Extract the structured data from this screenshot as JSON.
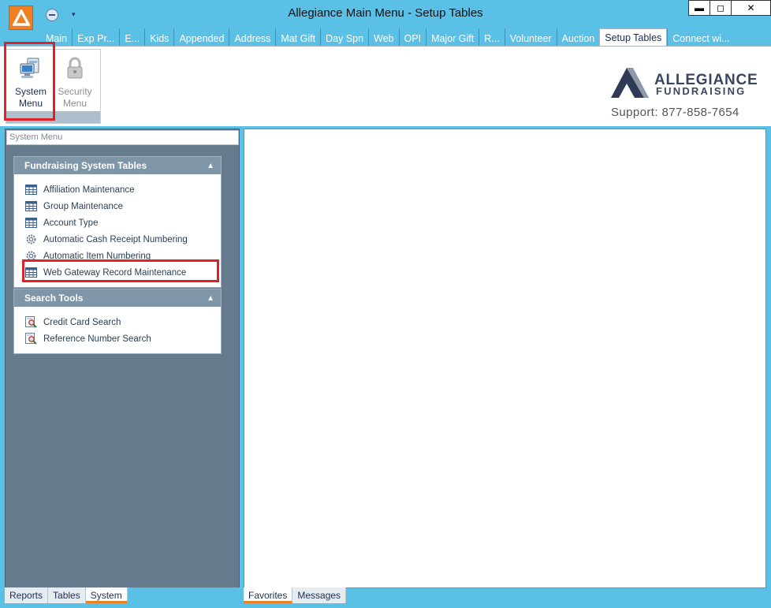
{
  "window": {
    "title": "Allegiance Main Menu - Setup Tables",
    "minimize_glyph": "▬",
    "maximize_glyph": "◻",
    "close_glyph": "✕",
    "qat_dropdown_glyph": "▾"
  },
  "tabs": [
    {
      "label": "Main",
      "active": false
    },
    {
      "label": "Exp Pr...",
      "active": false
    },
    {
      "label": "E...",
      "active": false
    },
    {
      "label": "Kids",
      "active": false
    },
    {
      "label": "Appended",
      "active": false
    },
    {
      "label": "Address",
      "active": false
    },
    {
      "label": "Mat Gift",
      "active": false
    },
    {
      "label": "Day Spn",
      "active": false
    },
    {
      "label": "Web",
      "active": false
    },
    {
      "label": "OPI",
      "active": false
    },
    {
      "label": "Major Gift",
      "active": false
    },
    {
      "label": "R...",
      "active": false
    },
    {
      "label": "Volunteer",
      "active": false
    },
    {
      "label": "Auction",
      "active": false
    },
    {
      "label": "Setup Tables",
      "active": true
    },
    {
      "label": "Connect wi...",
      "active": false
    }
  ],
  "ribbon": {
    "system_menu": {
      "line1": "System",
      "line2": "Menu",
      "icon": "computer-icon"
    },
    "security_menu": {
      "line1": "Security",
      "line2": "Menu",
      "icon": "lock-icon"
    }
  },
  "brand": {
    "name_line1": "ALLEGIANCE",
    "name_line2": "FUNDRAISING",
    "support": "Support: 877-858-7654"
  },
  "left_pane": {
    "header": "System Menu",
    "panels": [
      {
        "title": "Fundraising System Tables",
        "items": [
          {
            "label": "Affiliation Maintenance",
            "icon": "table-grid-icon"
          },
          {
            "label": "Group Maintenance",
            "icon": "table-grid-icon"
          },
          {
            "label": "Account Type",
            "icon": "table-grid-icon"
          },
          {
            "label": "Automatic Cash Receipt Numbering",
            "icon": "gear-icon"
          },
          {
            "label": "Automatic Item Numbering",
            "icon": "gear-icon"
          },
          {
            "label": "Web Gateway Record Maintenance",
            "icon": "table-grid-icon"
          }
        ]
      },
      {
        "title": "Search Tools",
        "items": [
          {
            "label": "Credit Card Search",
            "icon": "search-document-icon"
          },
          {
            "label": "Reference Number Search",
            "icon": "search-document-icon"
          }
        ]
      }
    ],
    "bottom_tabs": [
      {
        "label": "Reports",
        "active": false
      },
      {
        "label": "Tables",
        "active": false
      },
      {
        "label": "System",
        "active": true
      }
    ]
  },
  "right_pane": {
    "bottom_tabs": [
      {
        "label": "Favorites",
        "active": true
      },
      {
        "label": "Messages",
        "active": false
      }
    ]
  },
  "colors": {
    "chrome": "#5bc0e6",
    "accent": "#f07e22",
    "highlight": "#e0202b",
    "panel_header": "#7f96a8"
  }
}
